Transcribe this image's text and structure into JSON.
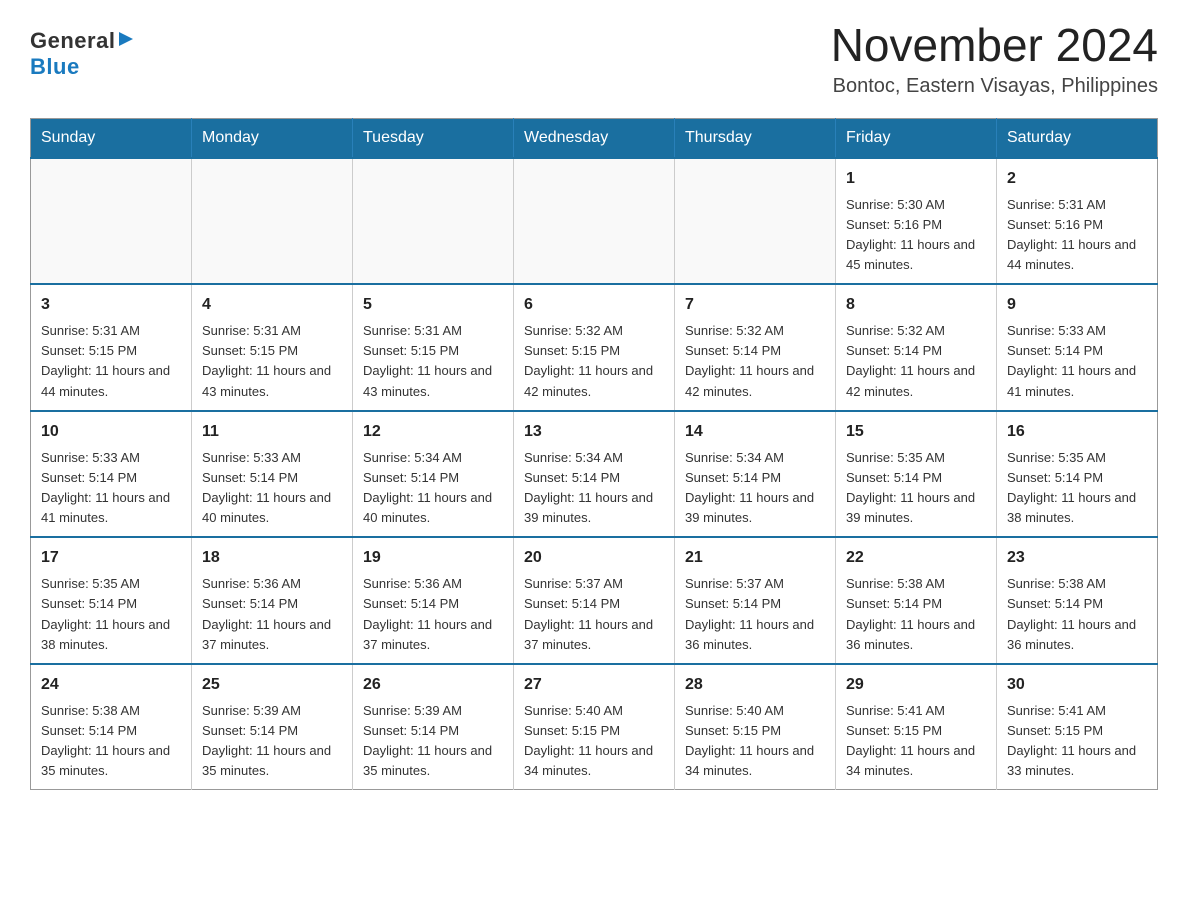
{
  "logo": {
    "text_general": "General",
    "text_blue": "Blue",
    "arrow": "▶"
  },
  "header": {
    "month_title": "November 2024",
    "location": "Bontoc, Eastern Visayas, Philippines"
  },
  "weekdays": [
    "Sunday",
    "Monday",
    "Tuesday",
    "Wednesday",
    "Thursday",
    "Friday",
    "Saturday"
  ],
  "weeks": [
    [
      {
        "day": "",
        "info": ""
      },
      {
        "day": "",
        "info": ""
      },
      {
        "day": "",
        "info": ""
      },
      {
        "day": "",
        "info": ""
      },
      {
        "day": "",
        "info": ""
      },
      {
        "day": "1",
        "info": "Sunrise: 5:30 AM\nSunset: 5:16 PM\nDaylight: 11 hours and 45 minutes."
      },
      {
        "day": "2",
        "info": "Sunrise: 5:31 AM\nSunset: 5:16 PM\nDaylight: 11 hours and 44 minutes."
      }
    ],
    [
      {
        "day": "3",
        "info": "Sunrise: 5:31 AM\nSunset: 5:15 PM\nDaylight: 11 hours and 44 minutes."
      },
      {
        "day": "4",
        "info": "Sunrise: 5:31 AM\nSunset: 5:15 PM\nDaylight: 11 hours and 43 minutes."
      },
      {
        "day": "5",
        "info": "Sunrise: 5:31 AM\nSunset: 5:15 PM\nDaylight: 11 hours and 43 minutes."
      },
      {
        "day": "6",
        "info": "Sunrise: 5:32 AM\nSunset: 5:15 PM\nDaylight: 11 hours and 42 minutes."
      },
      {
        "day": "7",
        "info": "Sunrise: 5:32 AM\nSunset: 5:14 PM\nDaylight: 11 hours and 42 minutes."
      },
      {
        "day": "8",
        "info": "Sunrise: 5:32 AM\nSunset: 5:14 PM\nDaylight: 11 hours and 42 minutes."
      },
      {
        "day": "9",
        "info": "Sunrise: 5:33 AM\nSunset: 5:14 PM\nDaylight: 11 hours and 41 minutes."
      }
    ],
    [
      {
        "day": "10",
        "info": "Sunrise: 5:33 AM\nSunset: 5:14 PM\nDaylight: 11 hours and 41 minutes."
      },
      {
        "day": "11",
        "info": "Sunrise: 5:33 AM\nSunset: 5:14 PM\nDaylight: 11 hours and 40 minutes."
      },
      {
        "day": "12",
        "info": "Sunrise: 5:34 AM\nSunset: 5:14 PM\nDaylight: 11 hours and 40 minutes."
      },
      {
        "day": "13",
        "info": "Sunrise: 5:34 AM\nSunset: 5:14 PM\nDaylight: 11 hours and 39 minutes."
      },
      {
        "day": "14",
        "info": "Sunrise: 5:34 AM\nSunset: 5:14 PM\nDaylight: 11 hours and 39 minutes."
      },
      {
        "day": "15",
        "info": "Sunrise: 5:35 AM\nSunset: 5:14 PM\nDaylight: 11 hours and 39 minutes."
      },
      {
        "day": "16",
        "info": "Sunrise: 5:35 AM\nSunset: 5:14 PM\nDaylight: 11 hours and 38 minutes."
      }
    ],
    [
      {
        "day": "17",
        "info": "Sunrise: 5:35 AM\nSunset: 5:14 PM\nDaylight: 11 hours and 38 minutes."
      },
      {
        "day": "18",
        "info": "Sunrise: 5:36 AM\nSunset: 5:14 PM\nDaylight: 11 hours and 37 minutes."
      },
      {
        "day": "19",
        "info": "Sunrise: 5:36 AM\nSunset: 5:14 PM\nDaylight: 11 hours and 37 minutes."
      },
      {
        "day": "20",
        "info": "Sunrise: 5:37 AM\nSunset: 5:14 PM\nDaylight: 11 hours and 37 minutes."
      },
      {
        "day": "21",
        "info": "Sunrise: 5:37 AM\nSunset: 5:14 PM\nDaylight: 11 hours and 36 minutes."
      },
      {
        "day": "22",
        "info": "Sunrise: 5:38 AM\nSunset: 5:14 PM\nDaylight: 11 hours and 36 minutes."
      },
      {
        "day": "23",
        "info": "Sunrise: 5:38 AM\nSunset: 5:14 PM\nDaylight: 11 hours and 36 minutes."
      }
    ],
    [
      {
        "day": "24",
        "info": "Sunrise: 5:38 AM\nSunset: 5:14 PM\nDaylight: 11 hours and 35 minutes."
      },
      {
        "day": "25",
        "info": "Sunrise: 5:39 AM\nSunset: 5:14 PM\nDaylight: 11 hours and 35 minutes."
      },
      {
        "day": "26",
        "info": "Sunrise: 5:39 AM\nSunset: 5:14 PM\nDaylight: 11 hours and 35 minutes."
      },
      {
        "day": "27",
        "info": "Sunrise: 5:40 AM\nSunset: 5:15 PM\nDaylight: 11 hours and 34 minutes."
      },
      {
        "day": "28",
        "info": "Sunrise: 5:40 AM\nSunset: 5:15 PM\nDaylight: 11 hours and 34 minutes."
      },
      {
        "day": "29",
        "info": "Sunrise: 5:41 AM\nSunset: 5:15 PM\nDaylight: 11 hours and 34 minutes."
      },
      {
        "day": "30",
        "info": "Sunrise: 5:41 AM\nSunset: 5:15 PM\nDaylight: 11 hours and 33 minutes."
      }
    ]
  ]
}
